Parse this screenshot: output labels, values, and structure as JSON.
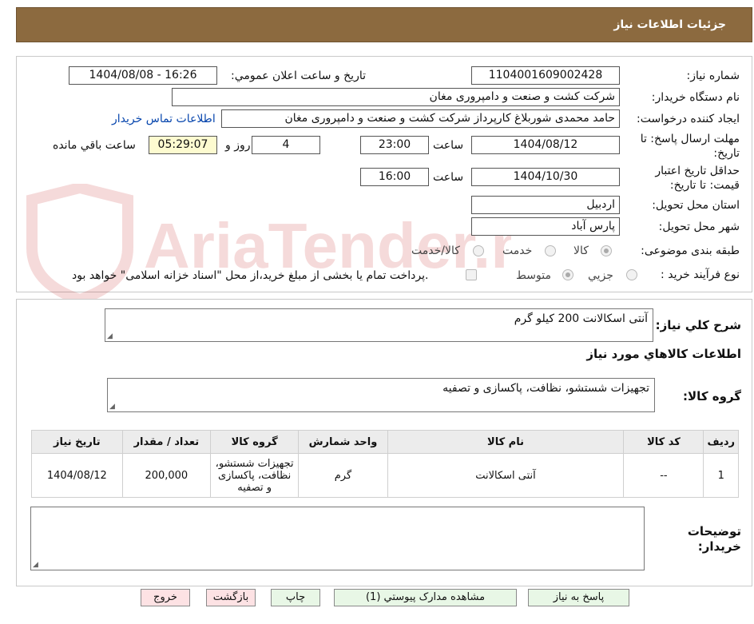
{
  "header": {
    "title": "جزئیات اطلاعات نیاز"
  },
  "fields": {
    "need_number_label": "شماره نیاز:",
    "need_number": "1104001609002428",
    "announce_label": "تاریخ و ساعت اعلان عمومي:",
    "announce_value": "1404/08/08 - 16:26",
    "buyer_org_label": "نام دستگاه خريدار:",
    "buyer_org": "شرکت کشت و صنعت و دامپروری مغان",
    "requester_label": "ايجاد کننده درخواست:",
    "requester": "حامد محمدی شوربلاغ کارپرداز شرکت کشت و صنعت و دامپروری مغان",
    "contact_link": "اطلاعات تماس خريدار",
    "deadline_label_1": "مهلت ارسال پاسخ: تا",
    "deadline_label_2": "تاريخ:",
    "deadline_date": "1404/08/12",
    "time_label": "ساعت",
    "deadline_time": "23:00",
    "days_value": "4",
    "days_label": "روز و",
    "remaining_time": "05:29:07",
    "remaining_label": "ساعت باقي مانده",
    "validity_label_1": "حداقل تاريخ اعتبار",
    "validity_label_2": "قيمت: تا تاريخ:",
    "validity_date": "1404/10/30",
    "validity_time": "16:00",
    "province_label": "استان محل تحويل:",
    "province": "اردبيل",
    "city_label": "شهر محل تحويل:",
    "city": "پارس آباد",
    "category_label": "طبقه بندی موضوعی:",
    "category_options": [
      "کالا",
      "خدمت",
      "کالا/خدمت"
    ],
    "process_label": "نوع فرآيند خريد :",
    "process_options": [
      "جزيي",
      "متوسط"
    ],
    "payment_note": "پرداخت تمام يا بخشی از مبلغ خريد،از محل \"اسناد خزانه اسلامی\" خواهد بود."
  },
  "summary": {
    "label": "شرح کلي نياز:",
    "text": "آنتی اسکالانت  200 کیلو گرم",
    "goods_info_title": "اطلاعات کالاهاي مورد نياز",
    "group_label": "گروه کالا:",
    "group_text": "تجهیزات شستشو، نظافت، پاکسازی و تصفیه"
  },
  "table": {
    "headers": [
      "رديف",
      "کد کالا",
      "نام کالا",
      "واحد شمارش",
      "گروه کالا",
      "تعداد / مقدار",
      "تاريخ نياز"
    ],
    "rows": [
      [
        "1",
        "--",
        "آنتی اسکالانت",
        "گرم",
        "تجهیزات شستشو، نظافت، پاکسازی و تصفیه",
        "200,000",
        "1404/08/12"
      ]
    ]
  },
  "notes": {
    "label_1": "توضيحات",
    "label_2": "خريدار:",
    "text": ""
  },
  "buttons": {
    "reply": "پاسخ به نياز",
    "attachments": "مشاهده مدارک پيوستي (1)",
    "print": "چاپ",
    "back": "بازگشت",
    "exit": "خروج"
  },
  "watermark": "AriaTender.neT",
  "colors": {
    "header_bg": "#8c6a3f",
    "link": "#0645ad",
    "highlight": "#fdfbd0"
  }
}
